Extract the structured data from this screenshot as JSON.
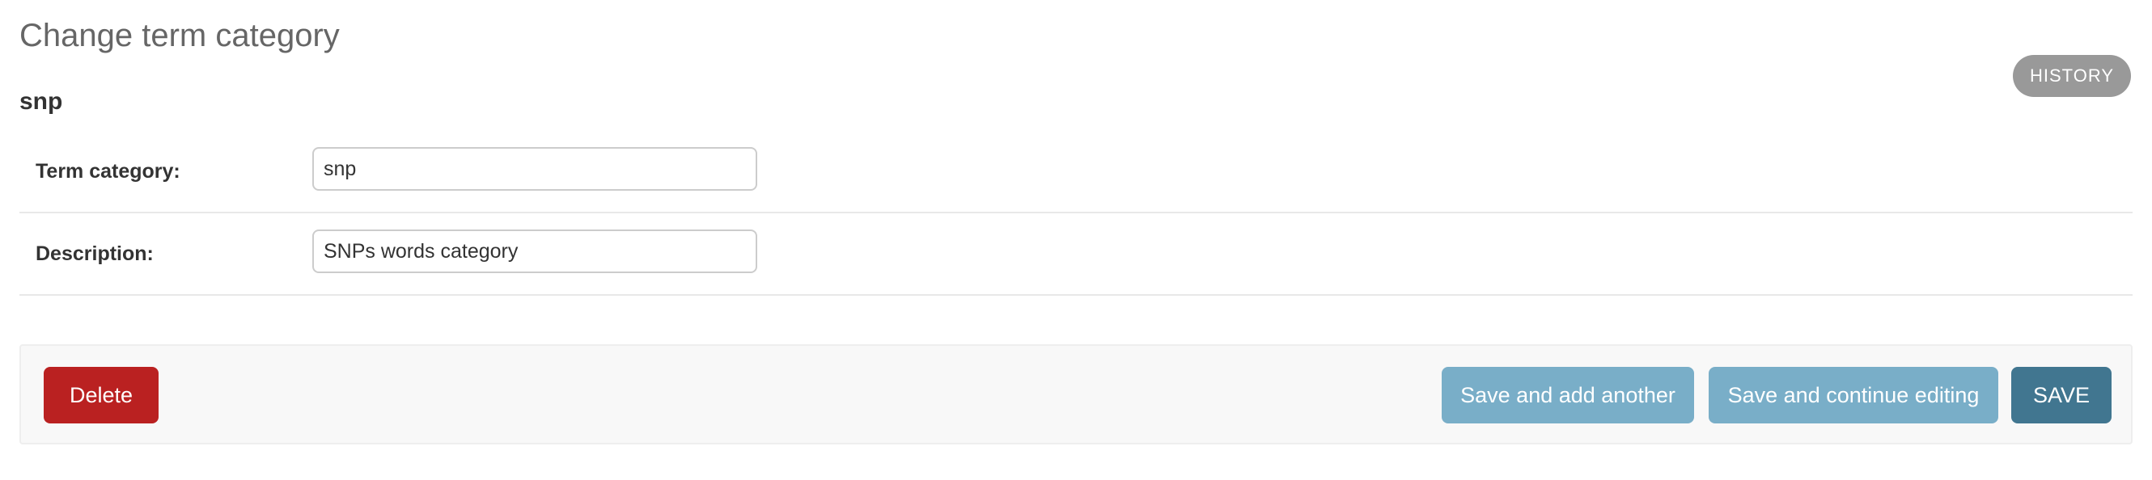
{
  "header": {
    "title": "Change term category",
    "history_label": "HISTORY"
  },
  "object": {
    "name": "snp"
  },
  "form": {
    "term_category": {
      "label": "Term category:",
      "value": "snp"
    },
    "description": {
      "label": "Description:",
      "value": "SNPs words category"
    }
  },
  "actions": {
    "delete_label": "Delete",
    "save_add_another_label": "Save and add another",
    "save_continue_label": "Save and continue editing",
    "save_label": "SAVE"
  },
  "colors": {
    "delete": "#ba2121",
    "secondary_save": "#79aec8",
    "primary_save": "#417690",
    "history": "#999999"
  }
}
